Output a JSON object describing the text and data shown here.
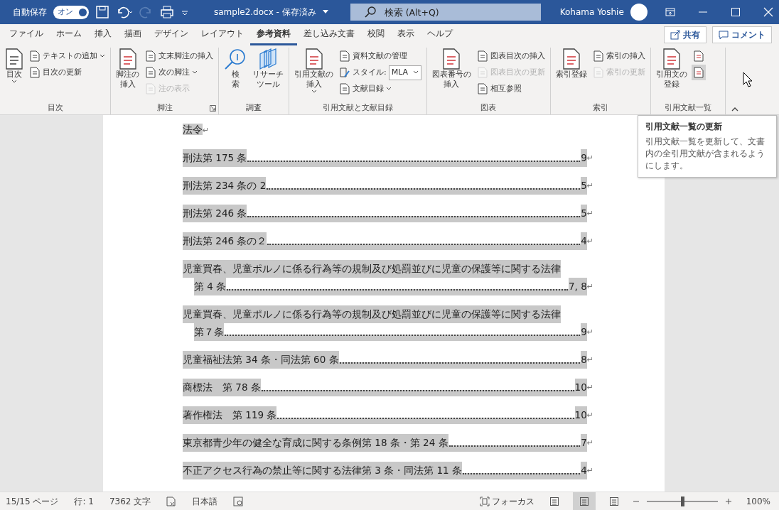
{
  "title_bar": {
    "autosave_label": "自動保存",
    "autosave_toggle": {
      "label": "オン",
      "on": true
    },
    "redo_disabled": true,
    "document_title": "sample2.docx - 保存済み",
    "search": {
      "placeholder": "検索 (Alt+Q)"
    },
    "user_name": "Kohama Yoshie"
  },
  "tabs": [
    {
      "label": "ファイル",
      "selected": false
    },
    {
      "label": "ホーム",
      "selected": false
    },
    {
      "label": "挿入",
      "selected": false
    },
    {
      "label": "描画",
      "selected": false
    },
    {
      "label": "デザイン",
      "selected": false
    },
    {
      "label": "レイアウト",
      "selected": false
    },
    {
      "label": "参考資料",
      "selected": true
    },
    {
      "label": "差し込み文書",
      "selected": false
    },
    {
      "label": "校閲",
      "selected": false
    },
    {
      "label": "表示",
      "selected": false
    },
    {
      "label": "ヘルプ",
      "selected": false
    }
  ],
  "tab_buttons": [
    "共有",
    "コメント"
  ],
  "ribbon_groups": [
    {
      "name": "目次",
      "launcher": false,
      "commands": [
        {
          "kind": "large",
          "lines": [
            "目次"
          ],
          "caret": true,
          "disabled": false
        },
        {
          "kind": "small",
          "label": "テキストの追加",
          "caret": true,
          "disabled": false
        },
        {
          "kind": "small",
          "label": "目次の更新",
          "caret": false,
          "disabled": false
        }
      ]
    },
    {
      "name": "脚注",
      "launcher": true,
      "commands": [
        {
          "kind": "large",
          "lines": [
            "脚注の",
            "挿入"
          ],
          "caret": false,
          "disabled": false
        },
        {
          "kind": "small",
          "label": "文末脚注の挿入",
          "caret": false,
          "disabled": false
        },
        {
          "kind": "small",
          "label": "次の脚注",
          "caret": true,
          "disabled": false
        },
        {
          "kind": "small",
          "label": "注の表示",
          "caret": false,
          "disabled": true
        }
      ]
    },
    {
      "name": "調査",
      "launcher": false,
      "commands": [
        {
          "kind": "large",
          "lines": [
            "検",
            "索"
          ],
          "caret": false,
          "disabled": false
        },
        {
          "kind": "large",
          "lines": [
            "リサーチ",
            "ツール"
          ],
          "caret": false,
          "disabled": false
        }
      ]
    },
    {
      "name": "引用文献と文献目録",
      "launcher": false,
      "commands": [
        {
          "kind": "large",
          "lines": [
            "引用文献の",
            "挿入"
          ],
          "caret": true,
          "disabled": false
        },
        {
          "kind": "small",
          "label": "資料文献の管理",
          "caret": false,
          "disabled": false
        },
        {
          "kind": "style",
          "label": "スタイル:",
          "value": "MLA"
        },
        {
          "kind": "small",
          "label": "文献目録",
          "caret": true,
          "disabled": false
        }
      ]
    },
    {
      "name": "図表",
      "launcher": false,
      "commands": [
        {
          "kind": "large",
          "lines": [
            "図表番号の",
            "挿入"
          ],
          "caret": false,
          "disabled": false
        },
        {
          "kind": "small",
          "label": "図表目次の挿入",
          "caret": false,
          "disabled": false
        },
        {
          "kind": "small",
          "label": "図表目次の更新",
          "caret": false,
          "disabled": true
        },
        {
          "kind": "small",
          "label": "相互参照",
          "caret": false,
          "disabled": false
        }
      ]
    },
    {
      "name": "索引",
      "launcher": false,
      "commands": [
        {
          "kind": "large",
          "lines": [
            "索引登録"
          ],
          "caret": false,
          "disabled": false
        },
        {
          "kind": "small",
          "label": "索引の挿入",
          "caret": false,
          "disabled": false
        },
        {
          "kind": "small",
          "label": "索引の更新",
          "caret": false,
          "disabled": true
        }
      ]
    },
    {
      "name": "引用文献一覧",
      "launcher": false,
      "commands": [
        {
          "kind": "large",
          "lines": [
            "引用文の",
            "登録"
          ],
          "caret": false,
          "disabled": false
        },
        {
          "kind": "icon",
          "hovered": false,
          "disabled": false
        },
        {
          "kind": "icon",
          "hovered": true,
          "disabled": false
        }
      ]
    }
  ],
  "tooltip": {
    "title": "引用文献一覧の更新",
    "text": "引用文献一覧を更新して、文書内の全引用文献が含まれるようにします。"
  },
  "document": {
    "heading": "法令",
    "heading_mark": "↵",
    "entries": [
      {
        "text": "刑法第 175 条",
        "page": "9",
        "mark": "↵"
      },
      {
        "text": "刑法第 234 条の 2",
        "page": "5",
        "mark": "↵"
      },
      {
        "text": "刑法第 246 条",
        "page": "5",
        "mark": "↵"
      },
      {
        "text": "刑法第 246 条の２",
        "page": "4",
        "mark": "↵"
      },
      {
        "text": "児童買春、児童ポルノに係る行為等の規制及び処罰並びに児童の保護等に関する法律",
        "continuation": "第 4 条",
        "page": "7, 8",
        "mark": "↵"
      },
      {
        "text": "児童買春、児童ポルノに係る行為等の規制及び処罰並びに児童の保護等に関する法律",
        "continuation": "第７条",
        "page": "9",
        "mark": "↵"
      },
      {
        "text": "児童福祉法第 34 条・同法第 60 条",
        "page": "8",
        "mark": "↵"
      },
      {
        "text": "商標法　第 78 条",
        "page": "10",
        "mark": "↵"
      },
      {
        "text": "著作権法　第 119 条",
        "page": "10",
        "mark": "↵"
      },
      {
        "text": "東京都青少年の健全な育成に関する条例第 18 条・第 24 条",
        "page": "7",
        "mark": "↵"
      },
      {
        "text": "不正アクセス行為の禁止等に関する法律第 3 条・同法第 11 条",
        "page": "4",
        "mark": "↵"
      }
    ]
  },
  "status_bar": {
    "page": "15/15 ページ",
    "line": "行: 1",
    "words": "7362 文字",
    "language": "日本語",
    "focus": "フォーカス",
    "views": [
      {
        "selected": false
      },
      {
        "selected": true
      },
      {
        "selected": false
      }
    ],
    "zoom": {
      "level": 0.5,
      "reading": "100%"
    }
  }
}
